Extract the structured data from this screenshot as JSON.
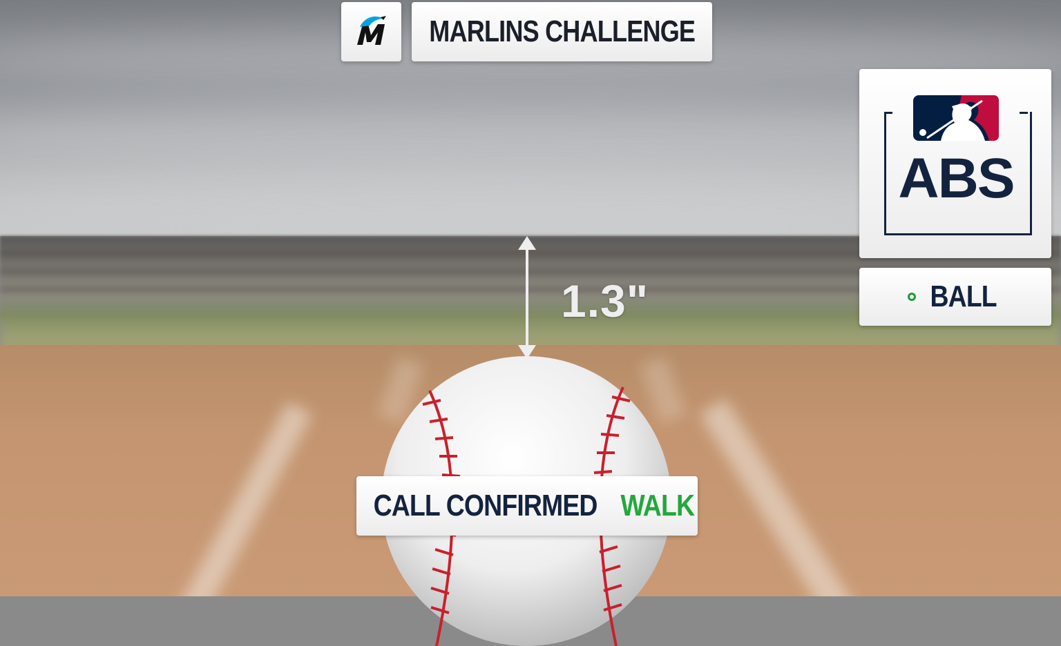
{
  "header": {
    "team_logo": "marlins-logo",
    "title": "MARLINS CHALLENGE"
  },
  "abs_panel": {
    "league_logo": "mlb-logo",
    "label": "ABS"
  },
  "result_panel": {
    "indicator_icon": "circle-outline-icon",
    "indicator_color": "#1f9a3a",
    "label": "BALL"
  },
  "measurement": {
    "value": "1.3\""
  },
  "call_banner": {
    "status": "CALL CONFIRMED",
    "outcome": "WALK",
    "outcome_color": "#23a83b"
  },
  "colors": {
    "navy": "#13233f",
    "mlb_blue": "#041e42",
    "mlb_red": "#bf0d3e",
    "marlins_teal": "#00a3e0",
    "seam_red": "#c8202c"
  }
}
